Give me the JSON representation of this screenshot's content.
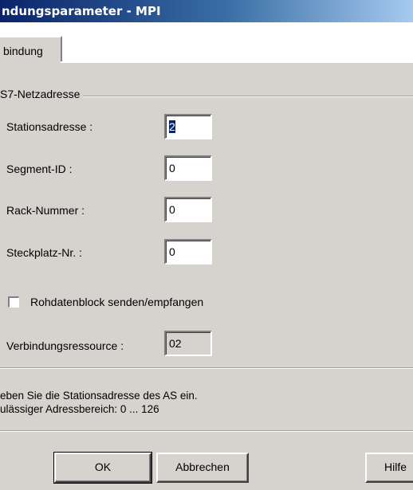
{
  "window": {
    "title": "ndungsparameter - MPI"
  },
  "tabs": [
    {
      "label": "bindung"
    }
  ],
  "group": {
    "title": "S7-Netzadresse"
  },
  "fields": {
    "stationsadresse": {
      "label": "Stationsadresse :",
      "value": "2"
    },
    "segment_id": {
      "label": "Segment-ID :",
      "value": "0"
    },
    "rack_nummer": {
      "label": "Rack-Nummer :",
      "value": "0"
    },
    "steckplatz_nr": {
      "label": "Steckplatz-Nr. :",
      "value": "0"
    }
  },
  "checkbox": {
    "label": "Rohdatenblock senden/empfangen",
    "checked": false
  },
  "verbindungsressource": {
    "label": "Verbindungsressource :",
    "value": "02"
  },
  "info": {
    "line1": "eben Sie die Stationsadresse des AS ein.",
    "line2": "ulässiger Adressbereich: 0 ... 126"
  },
  "buttons": {
    "ok": "OK",
    "cancel": "Abbrechen",
    "help": "Hilfe"
  },
  "colors": {
    "title_start": "#0a246a",
    "title_end": "#a6caf0",
    "face": "#d6d3ce"
  }
}
